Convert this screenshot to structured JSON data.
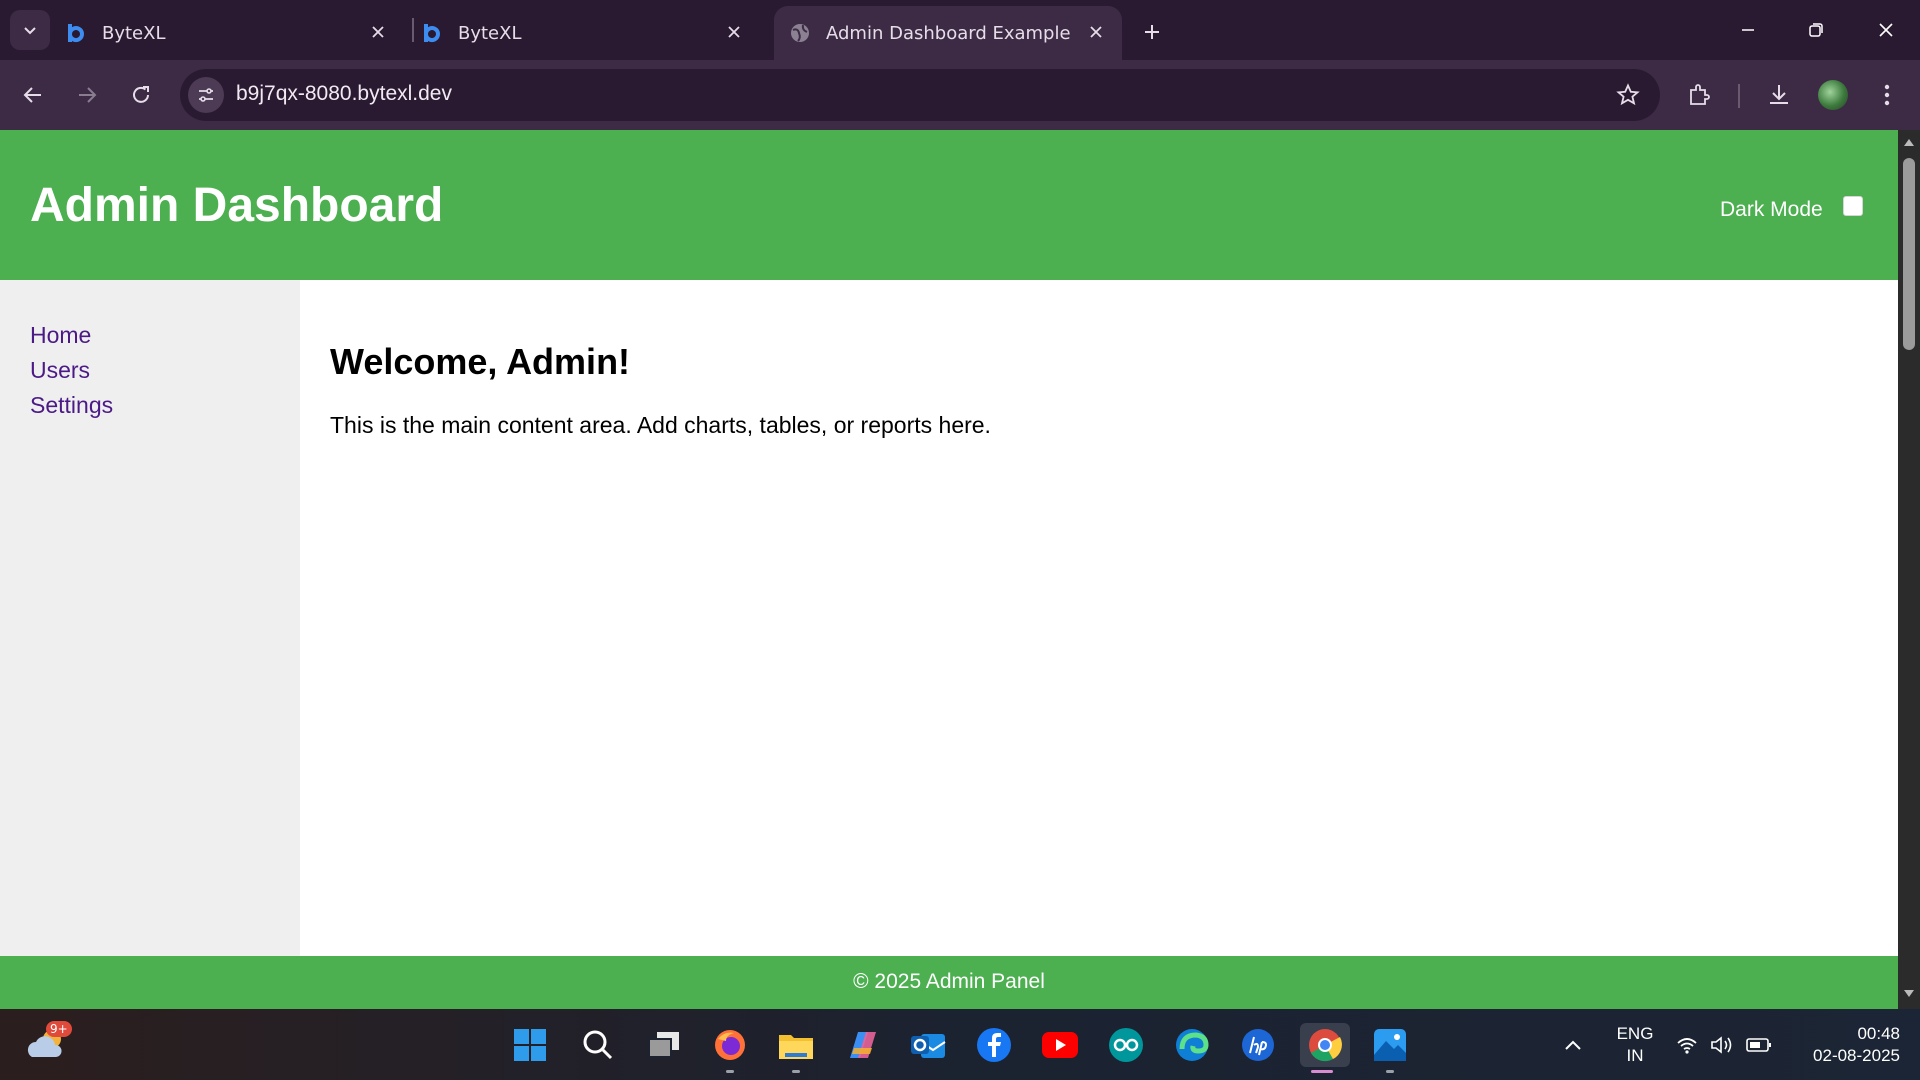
{
  "browser": {
    "tabs": [
      {
        "title": "ByteXL"
      },
      {
        "title": "ByteXL"
      },
      {
        "title": "Admin Dashboard Example"
      }
    ],
    "url": "b9j7qx-8080.bytexl.dev"
  },
  "header": {
    "title": "Admin Dashboard",
    "dark_mode_label": "Dark Mode",
    "dark_mode_checked": false
  },
  "sidebar": {
    "items": [
      {
        "label": "Home"
      },
      {
        "label": "Users"
      },
      {
        "label": "Settings"
      }
    ]
  },
  "main": {
    "heading": "Welcome, Admin!",
    "text": "This is the main content area. Add charts, tables, or reports here."
  },
  "footer": {
    "text": "© 2025 Admin Panel"
  },
  "taskbar": {
    "weather_badge": "9+",
    "language": {
      "line1": "ENG",
      "line2": "IN"
    },
    "time": "00:48",
    "date": "02-08-2025"
  },
  "colors": {
    "header_green": "#4caf50",
    "sidebar_bg": "#efefef",
    "link_purple": "#4b1a86",
    "chrome_dark": "#2a1a31",
    "chrome_toolbar": "#3d2b45"
  }
}
